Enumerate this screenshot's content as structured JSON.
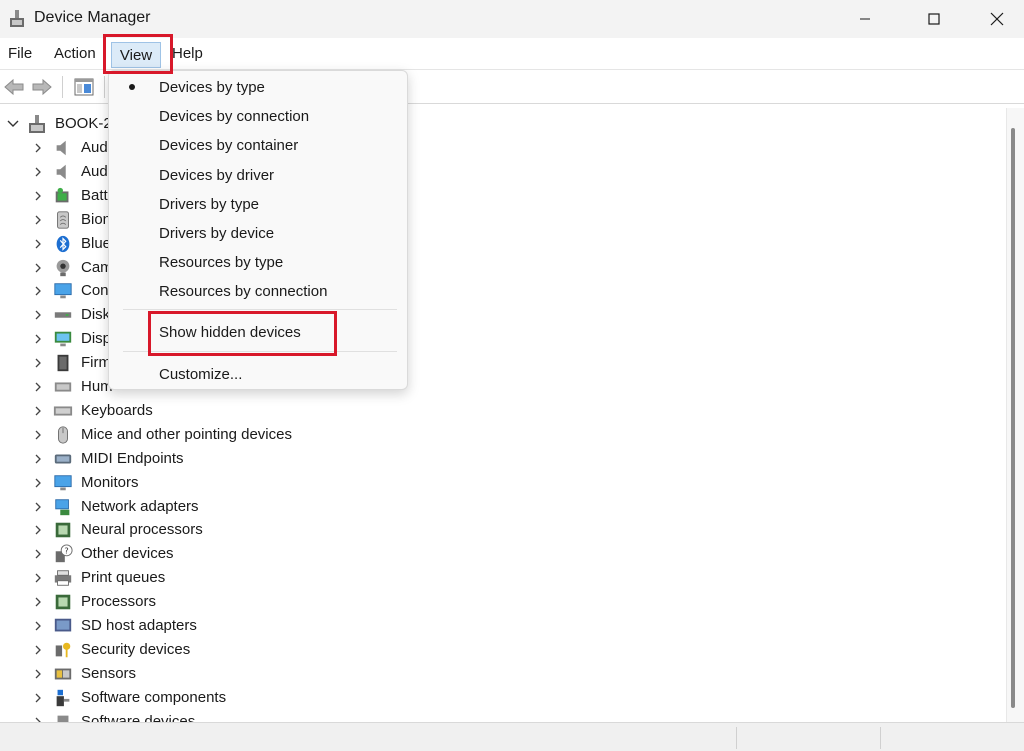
{
  "window": {
    "title": "Device Manager"
  },
  "menubar": {
    "file": "File",
    "action": "Action",
    "view": "View",
    "help": "Help"
  },
  "tree": {
    "root": "BOOK-2",
    "items": [
      {
        "label": "Aud",
        "icon": "speaker-icon"
      },
      {
        "label": "Aud",
        "icon": "speaker-icon"
      },
      {
        "label": "Batt",
        "icon": "battery-icon"
      },
      {
        "label": "Bion",
        "icon": "fingerprint-icon"
      },
      {
        "label": "Blue",
        "icon": "bluetooth-icon"
      },
      {
        "label": "Cam",
        "icon": "camera-icon"
      },
      {
        "label": "Con",
        "icon": "computer-icon"
      },
      {
        "label": "Disk",
        "icon": "disk-icon"
      },
      {
        "label": "Disp",
        "icon": "display-icon"
      },
      {
        "label": "Firm",
        "icon": "firmware-icon"
      },
      {
        "label": "Hum",
        "icon": "hid-icon"
      },
      {
        "label": "Keyboards",
        "icon": "keyboard-icon"
      },
      {
        "label": "Mice and other pointing devices",
        "icon": "mouse-icon"
      },
      {
        "label": "MIDI Endpoints",
        "icon": "midi-icon"
      },
      {
        "label": "Monitors",
        "icon": "monitor-icon"
      },
      {
        "label": "Network adapters",
        "icon": "network-icon"
      },
      {
        "label": "Neural processors",
        "icon": "chip-icon"
      },
      {
        "label": "Other devices",
        "icon": "unknown-device-icon"
      },
      {
        "label": "Print queues",
        "icon": "printer-icon"
      },
      {
        "label": "Processors",
        "icon": "chip-icon"
      },
      {
        "label": "SD host adapters",
        "icon": "sd-card-icon"
      },
      {
        "label": "Security devices",
        "icon": "key-icon"
      },
      {
        "label": "Sensors",
        "icon": "sensor-icon"
      },
      {
        "label": "Software components",
        "icon": "software-component-icon"
      },
      {
        "label": "Software devices",
        "icon": "software-device-icon"
      }
    ]
  },
  "view_menu": {
    "items": [
      {
        "label": "Devices by type",
        "checked": true
      },
      {
        "label": "Devices by connection"
      },
      {
        "label": "Devices by container"
      },
      {
        "label": "Devices by driver"
      },
      {
        "label": "Drivers by type"
      },
      {
        "label": "Drivers by device"
      },
      {
        "label": "Resources by type"
      },
      {
        "label": "Resources by connection"
      }
    ],
    "show_hidden": "Show hidden devices",
    "customize": "Customize..."
  },
  "colors": {
    "highlight": "#d8182a",
    "menu_active": "#dcebf8"
  }
}
